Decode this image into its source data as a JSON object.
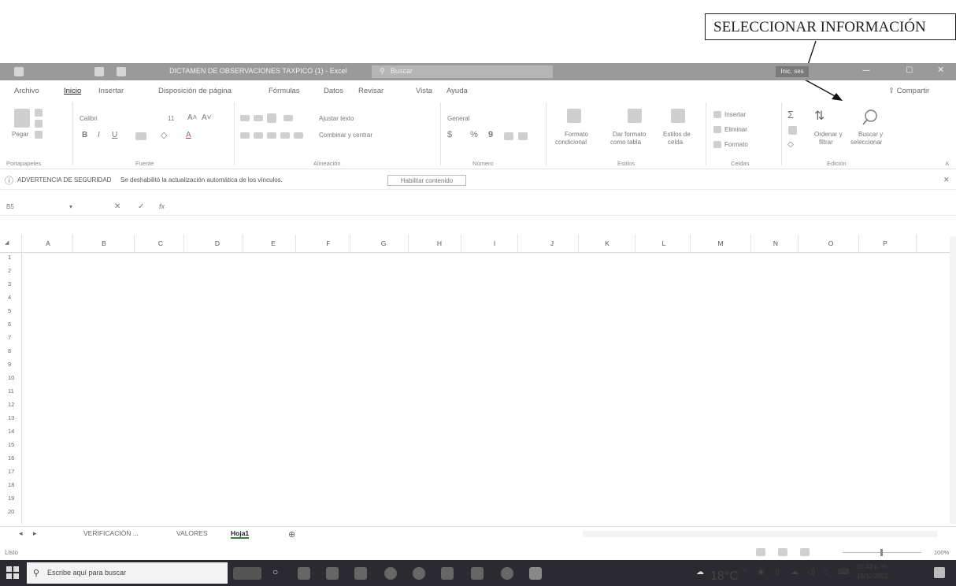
{
  "annotation": {
    "label": "SELECCIONAR INFORMACIÓN"
  },
  "window": {
    "title": "DICTAMEN DE OBSERVACIONES TAXPICO (1) - Excel",
    "search_placeholder": "Buscar",
    "signin_label": "Inic. ses"
  },
  "menu": {
    "tabs": [
      "Archivo",
      "Inicio",
      "Insertar",
      "Disposición de página",
      "Fórmulas",
      "Datos",
      "Revisar",
      "Vista",
      "Ayuda"
    ],
    "share_label": "Compartir"
  },
  "ribbon": {
    "clipboard": {
      "paste_label": "Pegar",
      "group_label": "Portapapeles"
    },
    "font": {
      "name": "Calibri",
      "size": "11",
      "group_label": "Fuente"
    },
    "alignment": {
      "wrap_label": "Ajustar texto",
      "merge_label": "Combinar y centrar",
      "group_label": "Alineación"
    },
    "number": {
      "format": "General",
      "currency": "$",
      "percent": "%",
      "comma": "9",
      "group_label": "Número"
    },
    "styles": {
      "conditional_label_1": "Formato",
      "conditional_label_2": "condicional",
      "as_table_label_1": "Dar formato",
      "as_table_label_2": "como tabla",
      "cell_styles_label_1": "Estilos de",
      "cell_styles_label_2": "celda",
      "group_label": "Estilos"
    },
    "cells": {
      "insert_label": "Insertar",
      "delete_label": "Eliminar",
      "format_label": "Formato",
      "group_label": "Celdas"
    },
    "editing": {
      "sort_label_1": "Ordenar y",
      "sort_label_2": "filtrar",
      "find_label_1": "Buscar y",
      "find_label_2": "seleccionar",
      "group_label": "Edición"
    }
  },
  "security_bar": {
    "title": "ADVERTENCIA DE SEGURIDAD",
    "message": "Se deshabilitó la actualización automática de los vínculos.",
    "button_label": "Habilitar contenido"
  },
  "formula_bar": {
    "name_box": "B5",
    "fx": "fx"
  },
  "grid": {
    "columns": [
      "A",
      "B",
      "C",
      "D",
      "E",
      "F",
      "G",
      "H",
      "I",
      "J",
      "K",
      "L",
      "M",
      "N",
      "O",
      "P"
    ],
    "rows": [
      "1",
      "2",
      "3",
      "4",
      "5",
      "6",
      "7",
      "8",
      "9",
      "10",
      "11",
      "12",
      "13",
      "14",
      "15",
      "16",
      "17",
      "18",
      "19",
      "20"
    ]
  },
  "sheets": {
    "tabs": [
      "VERIFICACIÓN ...",
      "VALORES",
      "Hoja1"
    ],
    "active": "Hoja1"
  },
  "status": {
    "ready_label": "Listo",
    "zoom": "100%"
  },
  "taskbar": {
    "search_placeholder": "Escribe aquí para buscar",
    "temperature": "18°C",
    "time": "01:43 p. m.",
    "date": "18/11/2022"
  }
}
